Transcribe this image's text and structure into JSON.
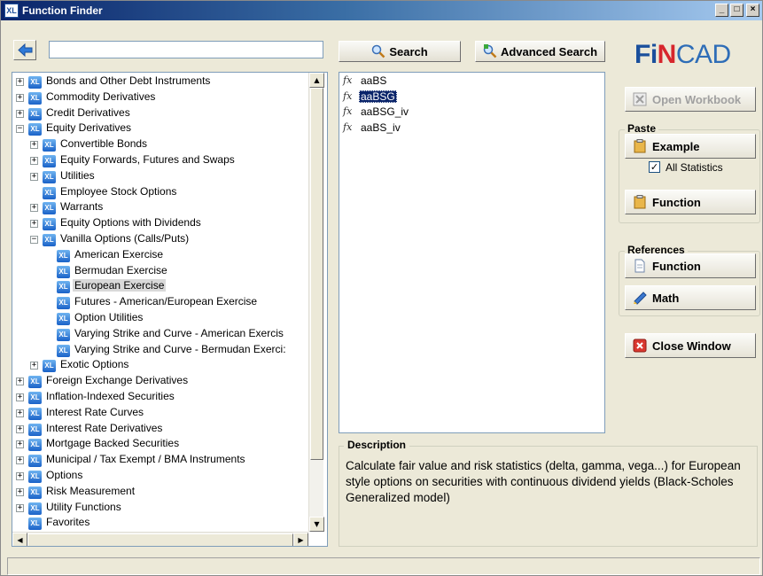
{
  "window": {
    "title": "Function Finder",
    "icon_label": "XL",
    "minimize": "_",
    "maximize": "□",
    "close": "×"
  },
  "nav": {
    "back_icon": "back-arrow-icon",
    "search_value": "",
    "search_button": "Search",
    "advanced_button": "Advanced Search"
  },
  "logo": {
    "part1": "Fi",
    "part2": "N",
    "part3": "CAD"
  },
  "tree": {
    "items": [
      {
        "label": "Bonds and Other Debt Instruments",
        "expander": "+",
        "level": 0
      },
      {
        "label": "Commodity Derivatives",
        "expander": "+",
        "level": 0
      },
      {
        "label": "Credit Derivatives",
        "expander": "+",
        "level": 0
      },
      {
        "label": "Equity Derivatives",
        "expander": "−",
        "level": 0
      },
      {
        "label": "Convertible Bonds",
        "expander": "+",
        "level": 1
      },
      {
        "label": "Equity Forwards, Futures and Swaps",
        "expander": "+",
        "level": 1
      },
      {
        "label": "Utilities",
        "expander": "+",
        "level": 1
      },
      {
        "label": "Employee Stock Options",
        "expander": "",
        "level": 1
      },
      {
        "label": "Warrants",
        "expander": "+",
        "level": 1
      },
      {
        "label": "Equity Options with Dividends",
        "expander": "+",
        "level": 1
      },
      {
        "label": "Vanilla Options (Calls/Puts)",
        "expander": "−",
        "level": 1
      },
      {
        "label": "American Exercise",
        "expander": "",
        "level": 2
      },
      {
        "label": "Bermudan Exercise",
        "expander": "",
        "level": 2
      },
      {
        "label": "European Exercise",
        "expander": "",
        "level": 2,
        "selected": true
      },
      {
        "label": "Futures - American/European Exercise",
        "expander": "",
        "level": 2
      },
      {
        "label": "Option Utilities",
        "expander": "",
        "level": 2
      },
      {
        "label": "Varying Strike and Curve - American Exercis",
        "expander": "",
        "level": 2
      },
      {
        "label": "Varying Strike and Curve - Bermudan Exerci:",
        "expander": "",
        "level": 2
      },
      {
        "label": "Exotic Options",
        "expander": "+",
        "level": 1
      },
      {
        "label": "Foreign Exchange Derivatives",
        "expander": "+",
        "level": 0
      },
      {
        "label": "Inflation-Indexed Securities",
        "expander": "+",
        "level": 0
      },
      {
        "label": "Interest Rate Curves",
        "expander": "+",
        "level": 0
      },
      {
        "label": "Interest Rate Derivatives",
        "expander": "+",
        "level": 0
      },
      {
        "label": "Mortgage Backed Securities",
        "expander": "+",
        "level": 0
      },
      {
        "label": "Municipal / Tax Exempt / BMA Instruments",
        "expander": "+",
        "level": 0
      },
      {
        "label": "Options",
        "expander": "+",
        "level": 0
      },
      {
        "label": "Risk Measurement",
        "expander": "+",
        "level": 0
      },
      {
        "label": "Utility Functions",
        "expander": "+",
        "level": 0
      },
      {
        "label": "Favorites",
        "expander": "",
        "level": 0
      }
    ]
  },
  "functions": {
    "items": [
      {
        "label": "aaBS",
        "selected": false
      },
      {
        "label": "aaBSG",
        "selected": true
      },
      {
        "label": "aaBSG_iv",
        "selected": false
      },
      {
        "label": "aaBS_iv",
        "selected": false
      }
    ]
  },
  "description": {
    "title": "Description",
    "text": "Calculate fair value and risk statistics (delta, gamma, vega...) for European style options on securities with continuous dividend yields (Black-Scholes Generalized model)"
  },
  "actions": {
    "open_workbook": "Open Workbook",
    "paste_title": "Paste",
    "example": "Example",
    "all_statistics": "All Statistics",
    "all_statistics_checked": true,
    "paste_function": "Function",
    "references_title": "References",
    "ref_function": "Function",
    "ref_math": "Math",
    "close_window": "Close Window"
  },
  "colors": {
    "titlebar_start": "#0a246a",
    "selection": "#0a246a",
    "logo_red": "#d7262d",
    "logo_blue": "#2e6db7"
  }
}
